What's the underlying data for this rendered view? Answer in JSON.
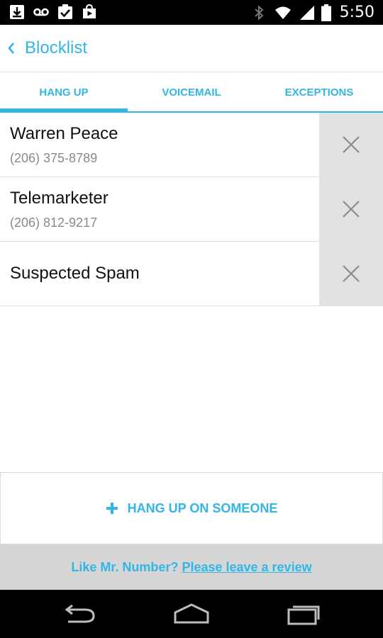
{
  "status_bar": {
    "time": "5:50",
    "left_icons": [
      "download-icon",
      "voicemail-icon",
      "task-check-icon",
      "play-store-icon"
    ],
    "right_icons": [
      "bluetooth-icon",
      "wifi-icon",
      "signal-icon",
      "battery-icon"
    ]
  },
  "header": {
    "title": "Blocklist"
  },
  "tabs": [
    {
      "label": "HANG UP",
      "active": true
    },
    {
      "label": "VOICEMAIL",
      "active": false
    },
    {
      "label": "EXCEPTIONS",
      "active": false
    }
  ],
  "blocklist": [
    {
      "name": "Warren Peace",
      "number": "(206) 375-8789"
    },
    {
      "name": "Telemarketer",
      "number": "(206) 812-9217"
    },
    {
      "name": "Suspected Spam",
      "number": ""
    }
  ],
  "add_button": {
    "label": "HANG UP ON SOMEONE"
  },
  "review": {
    "prefix": "Like Mr. Number?",
    "link": "Please leave a review"
  },
  "colors": {
    "accent": "#33b5e5",
    "remove_bg": "#e2e2e2",
    "review_bg": "#d6d6d6"
  },
  "nav_bar": {
    "icons": [
      "back-icon",
      "home-icon",
      "recents-icon"
    ]
  }
}
